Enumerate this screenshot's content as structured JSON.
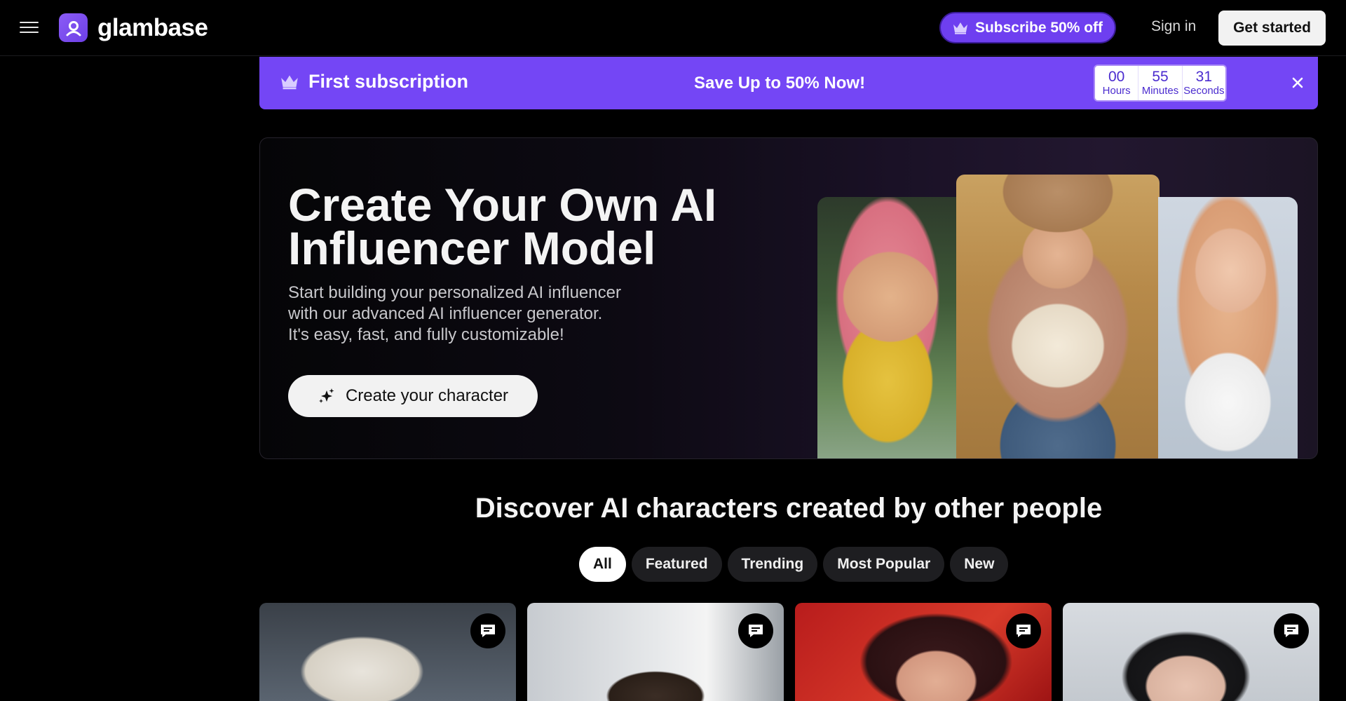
{
  "header": {
    "brand": "glambase",
    "subscribe_label": "Subscribe 50% off",
    "signin_label": "Sign in",
    "getstarted_label": "Get started"
  },
  "promo": {
    "title": "First subscription",
    "message": "Save Up to 50% Now!",
    "countdown": [
      {
        "value": "00",
        "label": "Hours"
      },
      {
        "value": "55",
        "label": "Minutes"
      },
      {
        "value": "31",
        "label": "Seconds"
      }
    ]
  },
  "hero": {
    "title": "Create Your Own AI\nInfluencer Model",
    "description": "Start building your personalized AI influencer\nwith our advanced AI influencer generator.\nIt's easy, fast, and fully customizable!",
    "cta_label": "Create your character"
  },
  "discover": {
    "title": "Discover AI characters created by other people",
    "filters": [
      "All",
      "Featured",
      "Trending",
      "Most Popular",
      "New"
    ],
    "active_filter": "All"
  },
  "colors": {
    "accent": "#7446f5",
    "background": "#000000"
  },
  "icons": {
    "menu": "hamburger-icon",
    "crown": "crown-icon",
    "close": "close-icon",
    "sparkle": "sparkle-icon",
    "chat": "chat-bubble-icon"
  }
}
